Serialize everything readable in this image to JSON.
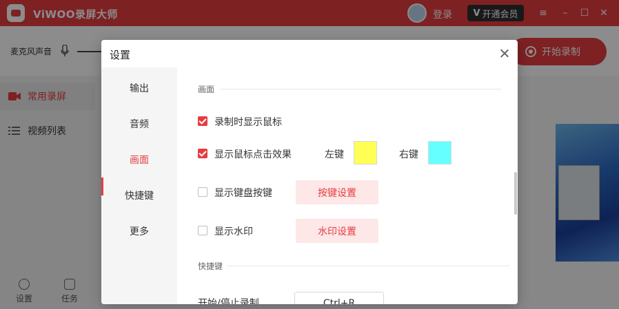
{
  "app": {
    "title": "ViWOO录屏大师",
    "login_label": "登录",
    "vip_label": "开通会员",
    "mic_label": "麦克风声音",
    "start_label": "开始录制",
    "sidebar": [
      {
        "label": "常用录屏",
        "icon": "video-icon",
        "active": true
      },
      {
        "label": "视频列表",
        "icon": "list-icon",
        "active": false
      }
    ],
    "bottom": {
      "settings": "设置",
      "tasks": "任务"
    },
    "accent": "#e63d40"
  },
  "dialog": {
    "title": "设置",
    "nav": [
      "输出",
      "音频",
      "画面",
      "快捷键",
      "更多"
    ],
    "nav_active": "画面",
    "section_display": "画面",
    "options": {
      "show_cursor": {
        "label": "录制时显示鼠标",
        "checked": true
      },
      "click_effect": {
        "label": "显示鼠标点击效果",
        "checked": true
      },
      "keyboard": {
        "label": "显示键盘按键",
        "checked": false
      },
      "watermark": {
        "label": "显示水印",
        "checked": false
      }
    },
    "left_key_label": "左键",
    "left_key_color": "#ffff55",
    "right_key_label": "右键",
    "right_key_color": "#66ffff",
    "key_settings_button": "按键设置",
    "watermark_settings_button": "水印设置",
    "section_shortcuts": "快捷键",
    "shortcut_start_stop_label": "开始/停止录制",
    "shortcut_start_stop_value": "Ctrl+R"
  }
}
